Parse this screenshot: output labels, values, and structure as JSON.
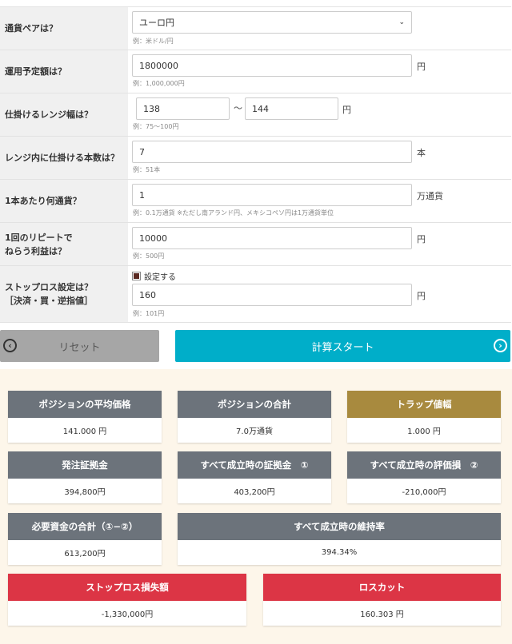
{
  "form": {
    "currency_pair": {
      "label": "通貨ペアは？",
      "value": "ユーロ円",
      "hint": "例：米ドル/円"
    },
    "amount": {
      "label": "運用予定額は？",
      "value": "1800000",
      "unit": "円",
      "hint": "例：1,000,000円"
    },
    "range": {
      "label": "仕掛けるレンジ幅は？",
      "from": "138",
      "sep": "～",
      "to": "144",
      "unit": "円",
      "hint": "例：75～100円"
    },
    "count": {
      "label": "レンジ内に仕掛ける本数は？",
      "value": "7",
      "unit": "本",
      "hint": "例：51本"
    },
    "lot": {
      "label": "1本あたり何通貨？",
      "value": "1",
      "unit": "万通貨",
      "hint": "例：0.1万通貨 ※ただし南アランド円、メキシコペソ円は1万通貨単位"
    },
    "profit": {
      "label1": "1回のリピートで",
      "label2": "ねらう利益は？",
      "value": "10000",
      "unit": "円",
      "hint": "例：500円"
    },
    "stoploss": {
      "label1": "ストップロス設定は？",
      "label2": "［決済・買・逆指値］",
      "checkbox_label": "設定する",
      "checked": true,
      "value": "160",
      "unit": "円",
      "hint": "例：101円"
    }
  },
  "buttons": {
    "reset": "リセット",
    "start": "計算スタート"
  },
  "results": [
    {
      "title": "ポジションの平均価格",
      "value": "141.000 円"
    },
    {
      "title": "ポジションの合計",
      "value": "7.0万通貨"
    },
    {
      "title": "トラップ値幅",
      "value": "1.000 円"
    },
    {
      "title": "発注証拠金",
      "value": "394,800円"
    },
    {
      "title": "すべて成立時の証拠金　①",
      "value": "403,200円"
    },
    {
      "title": "すべて成立時の評価損　②",
      "value": "-210,000円"
    },
    {
      "title": "必要資金の合計（①−②）",
      "value": "613,200円"
    },
    {
      "title": "すべて成立時の維持率",
      "value": "394.34%"
    },
    {
      "title": "ストップロス損失額",
      "value": "-1,330,000円"
    },
    {
      "title": "ロスカット",
      "value": "160.303 円"
    }
  ],
  "colors": {
    "header_gray": "#6c737b",
    "header_gold": "#a88a3e",
    "header_red": "#dc3545",
    "start": "#00aec9",
    "reset": "#a6a6a6"
  }
}
